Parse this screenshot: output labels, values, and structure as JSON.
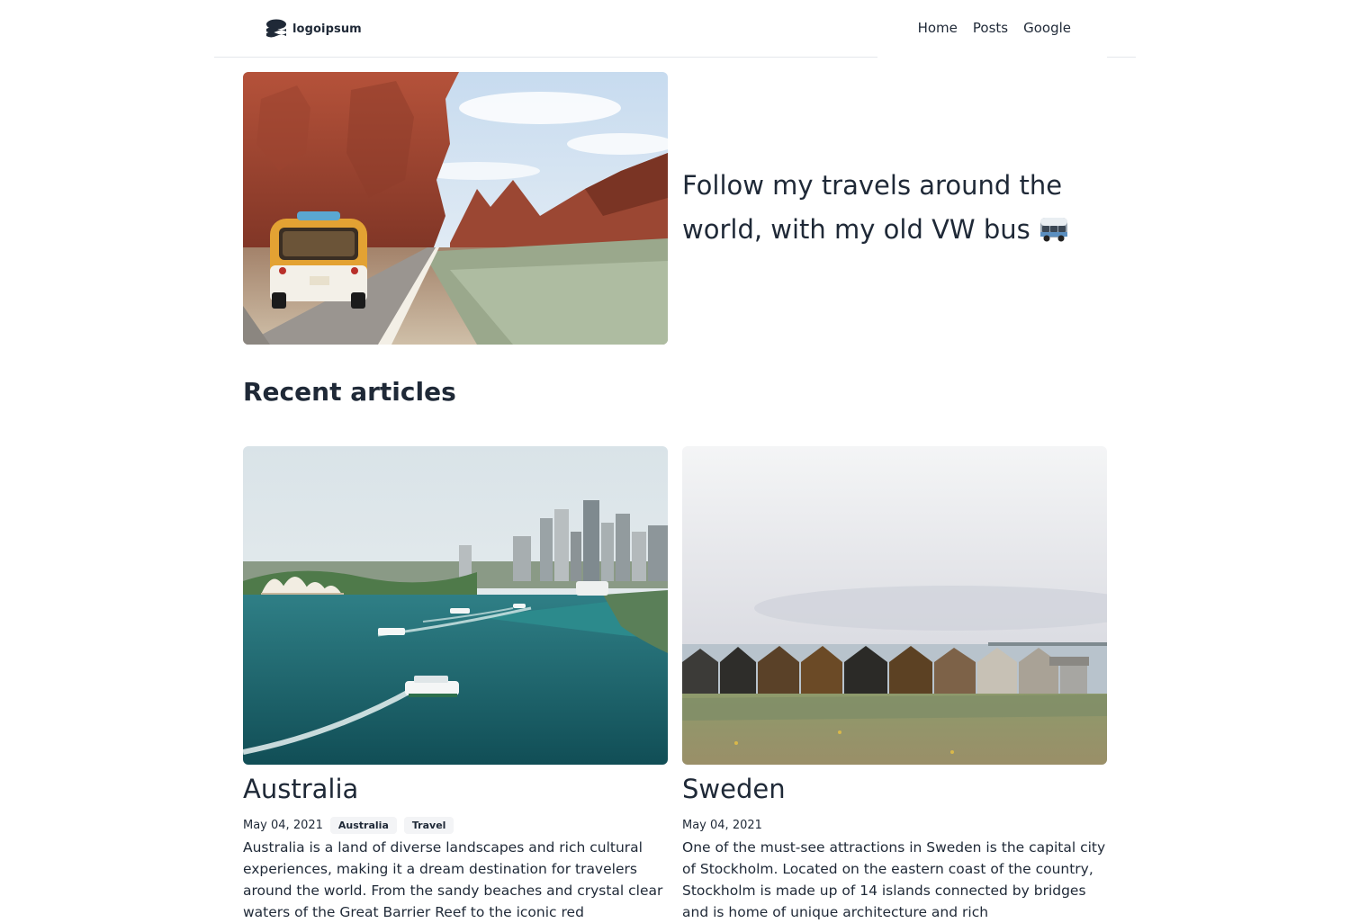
{
  "header": {
    "logo_text": "logoipsum",
    "logo_icon": "stacked-waves-logo-icon",
    "nav": [
      {
        "label": "Home"
      },
      {
        "label": "Posts"
      },
      {
        "label": "Google"
      }
    ]
  },
  "hero": {
    "image_icon": "desert-road-vw-bus-photo",
    "text": "Follow my travels around the world, with my old VW bus",
    "emoji": "minibus-icon"
  },
  "recent": {
    "title": "Recent articles",
    "articles": [
      {
        "title": "Australia",
        "date": "May 04, 2021",
        "tags": [
          "Australia",
          "Travel"
        ],
        "image_icon": "sydney-harbour-photo",
        "excerpt": "Australia is a land of diverse landscapes and rich cultural experiences, making it a dream destination for travelers around the world. From the sandy beaches and crystal clear waters of the Great Barrier Reef to the iconic red"
      },
      {
        "title": "Sweden",
        "date": "May 04, 2021",
        "tags": [],
        "image_icon": "swedish-boathouses-photo",
        "excerpt": "One of the must-see attractions in Sweden is the capital city of Stockholm. Located on the eastern coast of the country, Stockholm is made up of 14 islands connected by bridges and is home of unique architecture and rich"
      }
    ]
  },
  "colors": {
    "text": "#1f2937",
    "tag_bg": "#f3f4f6",
    "rule": "#e5e7eb"
  }
}
